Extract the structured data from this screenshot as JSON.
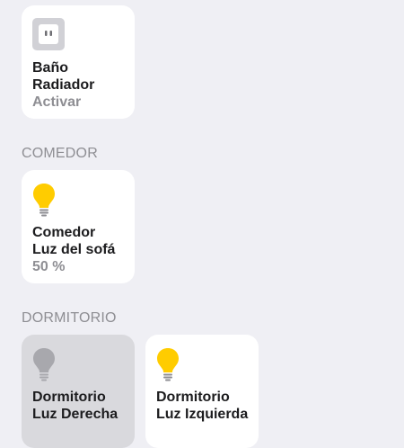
{
  "colors": {
    "background": "#efeff4",
    "tile_on": "#ffffff",
    "tile_off": "#d9d9dd",
    "bulb_on": "#ffcc00",
    "bulb_off": "#a8a8ad",
    "secondary_text": "#8e8e93"
  },
  "sections": [
    {
      "header": "",
      "tiles": [
        {
          "icon": "outlet-icon",
          "room": "Baño",
          "name": "Radiador",
          "status": "Activar",
          "on": true
        }
      ]
    },
    {
      "header": "COMEDOR",
      "tiles": [
        {
          "icon": "lightbulb-icon",
          "room": "Comedor",
          "name": "Luz del sofá",
          "status": "50 %",
          "brightness_percent": 50,
          "on": true
        }
      ]
    },
    {
      "header": "DORMITORIO",
      "tiles": [
        {
          "icon": "lightbulb-icon",
          "room": "Dormitorio",
          "name": "Luz Derecha",
          "on": false
        },
        {
          "icon": "lightbulb-icon",
          "room": "Dormitorio",
          "name": "Luz Izquierda",
          "on": true
        }
      ]
    }
  ]
}
